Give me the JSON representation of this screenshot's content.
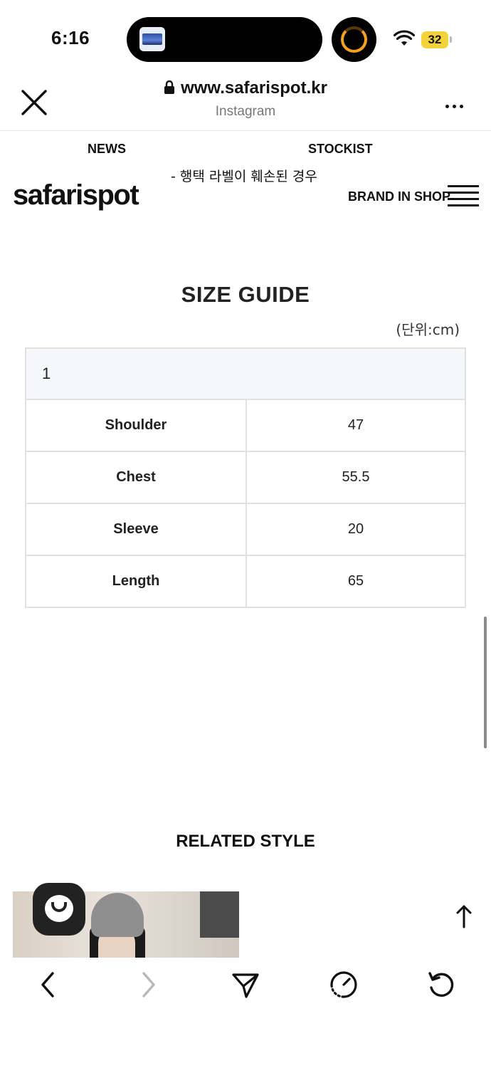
{
  "status_bar": {
    "time": "6:16",
    "battery": "32",
    "colors": {
      "battery": "#f2d43a",
      "activity_ring": "#f4a21c"
    },
    "icons": [
      "wifi-icon",
      "battery-icon",
      "app-thumbnail-icon",
      "timer-ring-icon"
    ]
  },
  "browser": {
    "url": "www.safarispot.kr",
    "source": "Instagram",
    "icons": [
      "close-icon",
      "lock-icon",
      "more-icon"
    ]
  },
  "site": {
    "nav": {
      "news": "NEWS",
      "stockist": "STOCKIST"
    },
    "notice": "- 행택 라벨이 훼손된 경우",
    "logo": "safarispot",
    "brand_in_shop": "BRAND IN SHOP",
    "menu_icon": "hamburger-menu-icon"
  },
  "size_guide": {
    "title": "SIZE GUIDE",
    "unit": "(단위:cm)",
    "header": "1",
    "rows": [
      {
        "label": "Shoulder",
        "value": "47"
      },
      {
        "label": "Chest",
        "value": "55.5"
      },
      {
        "label": "Sleeve",
        "value": "20"
      },
      {
        "label": "Length",
        "value": "65"
      }
    ]
  },
  "related": {
    "title": "RELATED STYLE"
  },
  "toolbar": {
    "icons": [
      "back-arrow-icon",
      "forward-arrow-icon",
      "share-icon",
      "speed-dial-icon",
      "reload-icon"
    ],
    "scroll_top_icon": "scroll-to-top-arrow-icon",
    "chat_icon": "chat-bubble-icon"
  }
}
